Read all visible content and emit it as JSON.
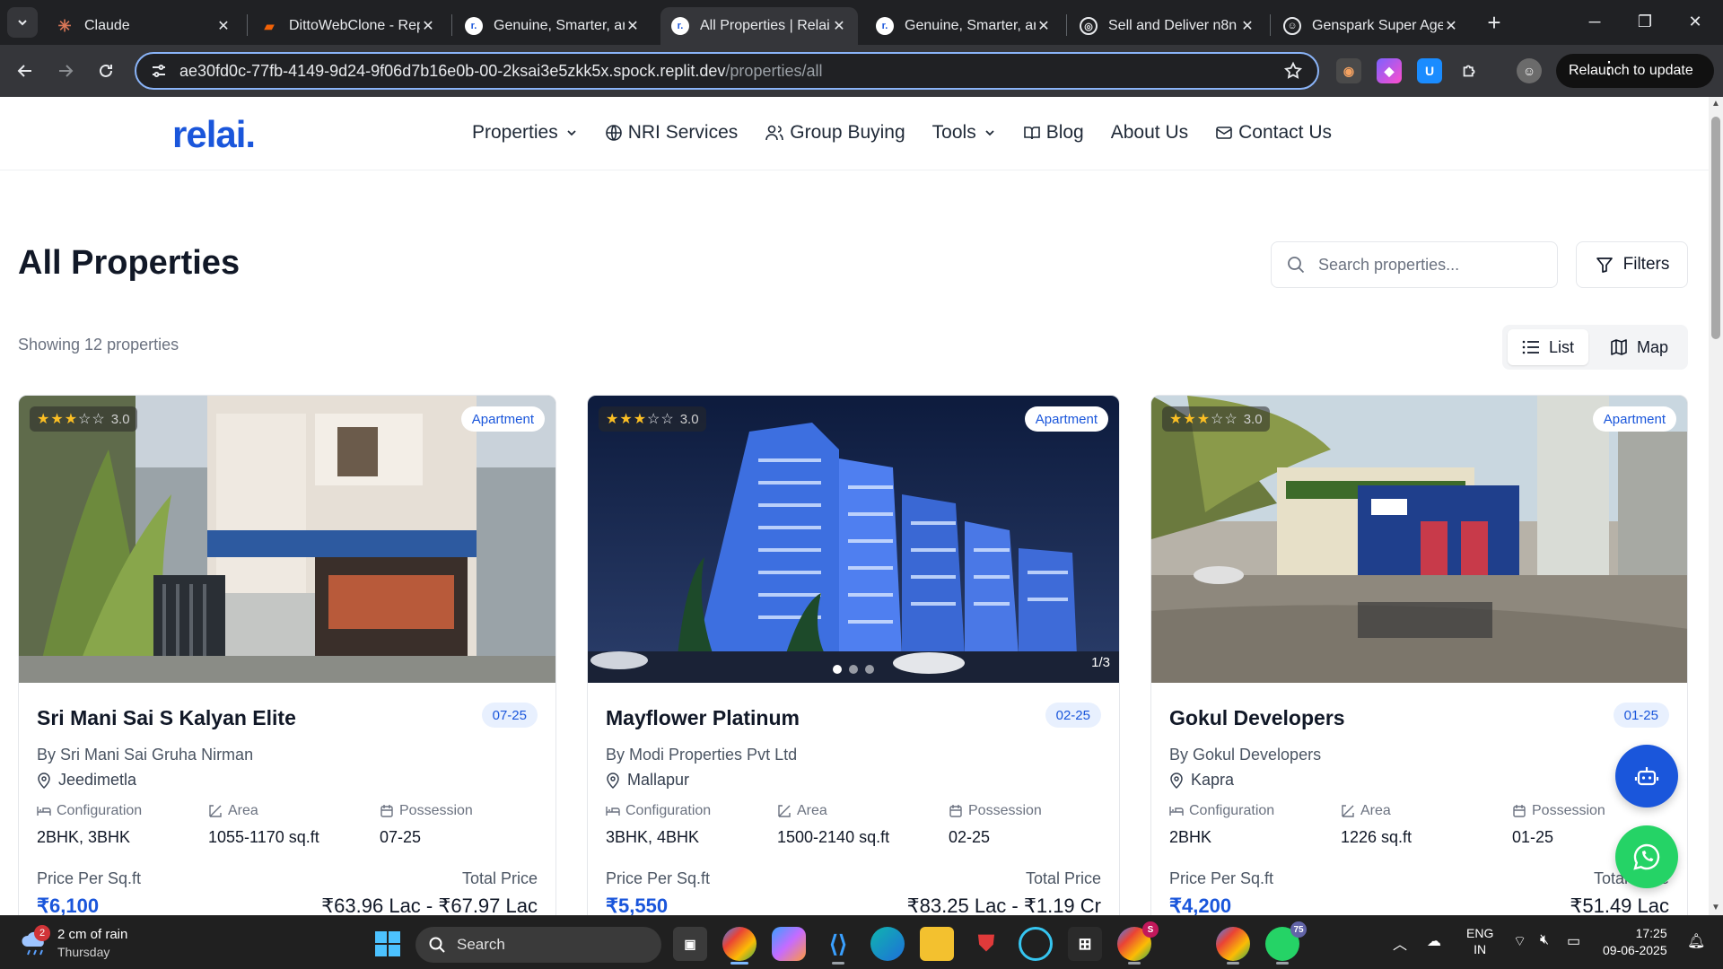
{
  "browser": {
    "tabs": [
      {
        "title": "Claude",
        "active": false
      },
      {
        "title": "DittoWebClone - Rep",
        "active": false
      },
      {
        "title": "Genuine, Smarter, an",
        "active": false
      },
      {
        "title": "All Properties | Relai",
        "active": true
      },
      {
        "title": "Genuine, Smarter, an",
        "active": false
      },
      {
        "title": "Sell and Deliver n8n",
        "active": false
      },
      {
        "title": "Genspark Super Agen",
        "active": false
      }
    ],
    "url_host": "ae30fd0c-77fb-4149-9d24-9f06d7b16e0b-00-2ksai3e5zkk5x.spock.replit.dev",
    "url_path": "/properties/all",
    "relaunch_label": "Relaunch to update"
  },
  "site": {
    "logo": "relai.",
    "nav": {
      "properties": "Properties",
      "nri": "NRI Services",
      "group": "Group Buying",
      "tools": "Tools",
      "blog": "Blog",
      "about": "About Us",
      "contact": "Contact Us"
    }
  },
  "page": {
    "title": "All Properties",
    "search_placeholder": "Search properties...",
    "filters_label": "Filters",
    "showing": "Showing 12 properties",
    "view_list": "List",
    "view_map": "Map"
  },
  "labels": {
    "configuration": "Configuration",
    "area": "Area",
    "possession": "Possession",
    "price_per_sqft": "Price Per Sq.ft",
    "total_price": "Total Price"
  },
  "properties": [
    {
      "rating": "3.0",
      "type": "Apartment",
      "name": "Sri Mani Sai S Kalyan Elite",
      "date": "07-25",
      "builder": "By Sri Mani Sai Gruha Nirman",
      "location": "Jeedimetla",
      "configuration": "2BHK, 3BHK",
      "area": "1055-1170 sq.ft",
      "possession": "07-25",
      "price": "₹6,100",
      "total": "₹63.96 Lac - ₹67.97 Lac"
    },
    {
      "rating": "3.0",
      "type": "Apartment",
      "name": "Mayflower Platinum",
      "date": "02-25",
      "builder": "By Modi Properties Pvt Ltd",
      "location": "Mallapur",
      "configuration": "3BHK, 4BHK",
      "area": "1500-2140 sq.ft",
      "possession": "02-25",
      "price": "₹5,550",
      "total": "₹83.25 Lac - ₹1.19 Cr",
      "image_counter": "1/3"
    },
    {
      "rating": "3.0",
      "type": "Apartment",
      "name": "Gokul Developers",
      "date": "01-25",
      "builder": "By Gokul Developers",
      "location": "Kapra",
      "configuration": "2BHK",
      "area": "1226 sq.ft",
      "possession": "01-25",
      "price": "₹4,200",
      "total": "₹51.49 Lac"
    }
  ],
  "taskbar": {
    "weather_line1": "2 cm of rain",
    "weather_line2": "Thursday",
    "weather_badge": "2",
    "search_label": "Search",
    "whatsapp_count": "75",
    "lang_line1": "ENG",
    "lang_line2": "IN",
    "time": "17:25",
    "date": "09-06-2025"
  }
}
